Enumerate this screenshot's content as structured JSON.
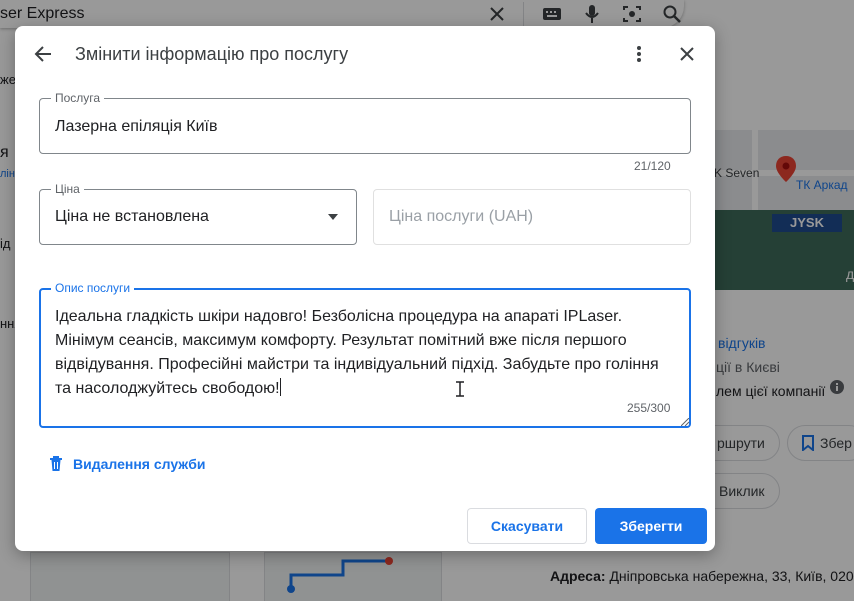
{
  "background": {
    "search_text": "ser Express",
    "left_fragments": [
      "же",
      "я",
      "лін",
      "ід",
      "ння"
    ],
    "map_labels": {
      "place_1": "K Seven",
      "place_2": "ТК Аркад",
      "store": "JYSK",
      "corner": "д"
    },
    "reviews_link": "відгуків",
    "category_text": "ції в Києві",
    "owner_text": "лем цієї компанії",
    "routes_button": "ршрути",
    "save_button": "Збер",
    "call_button": "Виклик",
    "address_label": "Адреса:",
    "address_value": "Дніпровська набережна, 33, Київ, 020"
  },
  "dialog": {
    "title": "Змінити інформацію про послугу",
    "service_field": {
      "label": "Послуга",
      "value": "Лазерна епіляція Київ",
      "counter": "21/120"
    },
    "price_field": {
      "label": "Ціна",
      "value": "Ціна не встановлена"
    },
    "price_amount_field": {
      "placeholder": "Ціна послуги (UAH)"
    },
    "description_field": {
      "label": "Опис послуги",
      "value": "Ідеальна гладкість шкіри надовго! Безболісна процедура на апараті IPLaser. Мінімум сеансів, максимум комфорту. Результат помітний вже після першого відвідування. Професійні майстри та індивідуальний підхід. Забудьте про гоління та насолоджуйтесь свободою!",
      "counter": "255/300"
    },
    "delete_label": "Видалення служби",
    "cancel_label": "Скасувати",
    "save_label": "Зберегти"
  },
  "colors": {
    "accent": "#1a73e8",
    "field_border": "#80868b",
    "overlay": "rgba(0,0,0,0.40)"
  },
  "icons": [
    "back-arrow-icon",
    "more-vert-icon",
    "close-icon",
    "dropdown-arrow-icon",
    "trash-icon",
    "keyboard-icon",
    "mic-icon",
    "camera-search-icon",
    "search-icon",
    "info-icon",
    "bookmark-icon",
    "text-cursor-icon"
  ]
}
